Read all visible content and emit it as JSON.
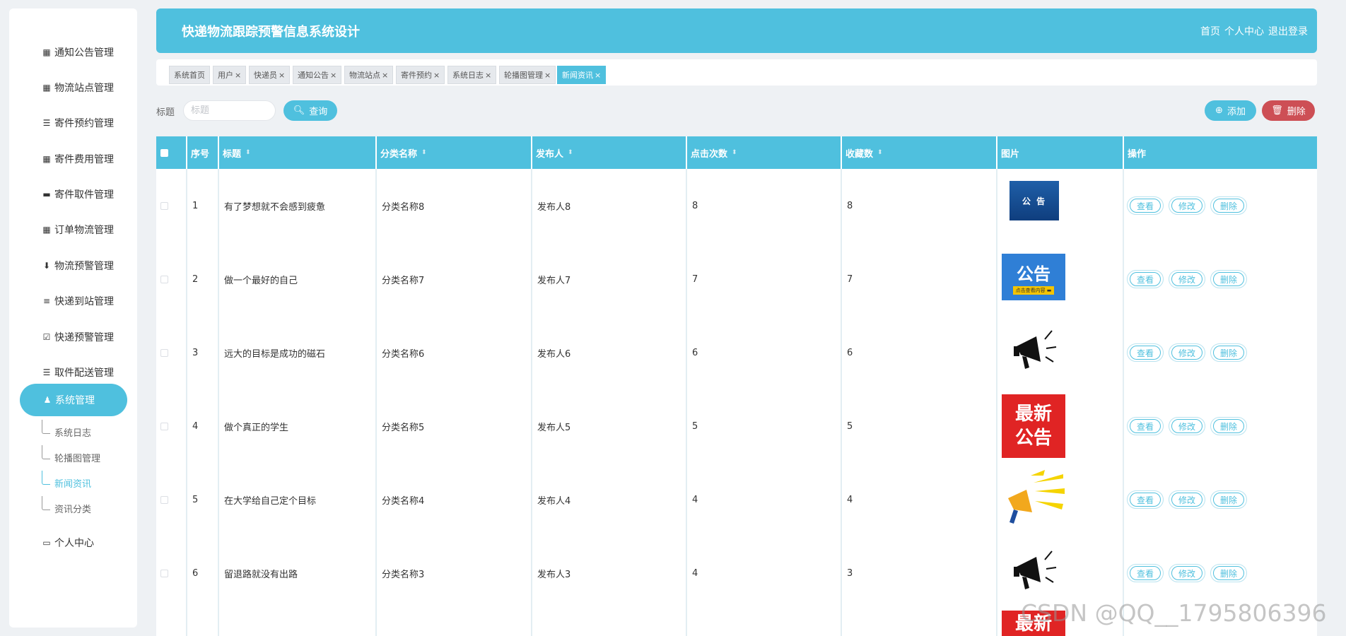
{
  "header": {
    "title": "快递物流跟踪预警信息系统设计",
    "nav": [
      "首页",
      "个人中心",
      "退出登录"
    ]
  },
  "sidebar": {
    "items": [
      {
        "label": "通知公告管理",
        "icon": "grid-icon"
      },
      {
        "label": "物流站点管理",
        "icon": "grid-icon"
      },
      {
        "label": "寄件预约管理",
        "icon": "list-icon"
      },
      {
        "label": "寄件费用管理",
        "icon": "grid-icon"
      },
      {
        "label": "寄件取件管理",
        "icon": "monitor-icon"
      },
      {
        "label": "订单物流管理",
        "icon": "grid-icon"
      },
      {
        "label": "物流预警管理",
        "icon": "pin-icon"
      },
      {
        "label": "快递到站管理",
        "icon": "sliders-icon"
      },
      {
        "label": "快递预警管理",
        "icon": "clipboard-check-icon"
      },
      {
        "label": "取件配送管理",
        "icon": "list-icon"
      },
      {
        "label": "系统管理",
        "icon": "user-icon"
      }
    ],
    "sub_items": [
      "系统日志",
      "轮播图管理",
      "新闻资讯",
      "资讯分类"
    ],
    "personal": "个人中心"
  },
  "tabs": [
    {
      "label": "系统首页",
      "closable": false
    },
    {
      "label": "用户",
      "closable": true
    },
    {
      "label": "快递员",
      "closable": true
    },
    {
      "label": "通知公告",
      "closable": true
    },
    {
      "label": "物流站点",
      "closable": true
    },
    {
      "label": "寄件预约",
      "closable": true
    },
    {
      "label": "系统日志",
      "closable": true
    },
    {
      "label": "轮播图管理",
      "closable": true
    },
    {
      "label": "新闻资讯",
      "closable": true
    }
  ],
  "tab_close": "×",
  "search": {
    "label": "标题",
    "placeholder": "标题",
    "query_label": "查询",
    "add_label": "添加",
    "delete_label": "删除"
  },
  "table": {
    "headers": [
      "序号",
      "标题",
      "分类名称",
      "发布人",
      "点击次数",
      "收藏数",
      "图片",
      "操作"
    ],
    "actions": [
      "查看",
      "修改",
      "删除"
    ],
    "rows": [
      {
        "no": "1",
        "title": "有了梦想就不会感到疲惫",
        "category": "分类名称8",
        "publisher": "发布人8",
        "clicks": "8",
        "favorites": "8",
        "image": "blue-notice"
      },
      {
        "no": "2",
        "title": "做一个最好的自己",
        "category": "分类名称7",
        "publisher": "发布人7",
        "clicks": "7",
        "favorites": "7",
        "image": "blue-gonggao"
      },
      {
        "no": "3",
        "title": "远大的目标是成功的磁石",
        "category": "分类名称6",
        "publisher": "发布人6",
        "clicks": "6",
        "favorites": "6",
        "image": "megaphone-black"
      },
      {
        "no": "4",
        "title": "做个真正的学生",
        "category": "分类名称5",
        "publisher": "发布人5",
        "clicks": "5",
        "favorites": "5",
        "image": "red-latest"
      },
      {
        "no": "5",
        "title": "在大学给自己定个目标",
        "category": "分类名称4",
        "publisher": "发布人4",
        "clicks": "4",
        "favorites": "4",
        "image": "megaphone-yellow"
      },
      {
        "no": "6",
        "title": "留退路就没有出路",
        "category": "分类名称3",
        "publisher": "发布人3",
        "clicks": "4",
        "favorites": "3",
        "image": "megaphone-black"
      }
    ]
  },
  "image_text": {
    "notice": "公 告",
    "gonggao": "公告",
    "gonggao_sub": "点击查看内容 ▬",
    "latest_1": "最新",
    "latest_2": "公告"
  },
  "colors": {
    "primary": "#4fc0de",
    "danger": "#cd4f55"
  },
  "watermark": "CSDN @QQ__1795806396"
}
